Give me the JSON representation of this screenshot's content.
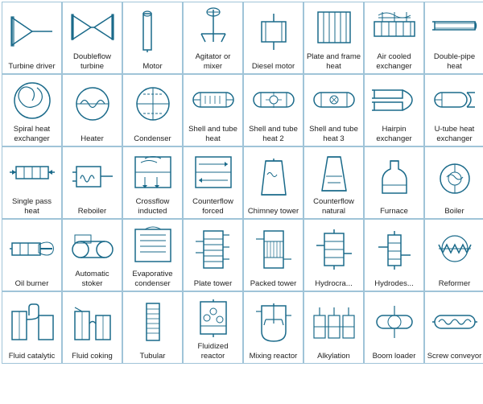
{
  "cells": [
    {
      "label": "Turbine driver"
    },
    {
      "label": "Doubleflow turbine"
    },
    {
      "label": "Motor"
    },
    {
      "label": "Agitator or mixer"
    },
    {
      "label": "Diesel motor"
    },
    {
      "label": "Plate and frame heat"
    },
    {
      "label": "Air cooled exchanger"
    },
    {
      "label": "Double-pipe heat"
    },
    {
      "label": "Spiral heat exchanger"
    },
    {
      "label": "Heater"
    },
    {
      "label": "Condenser"
    },
    {
      "label": "Shell and tube heat"
    },
    {
      "label": "Shell and tube heat 2"
    },
    {
      "label": "Shell and tube heat 3"
    },
    {
      "label": "Hairpin exchanger"
    },
    {
      "label": "U-tube heat exchanger"
    },
    {
      "label": "Single pass heat"
    },
    {
      "label": "Reboiler"
    },
    {
      "label": "Crossflow inducted"
    },
    {
      "label": "Counterflow forced"
    },
    {
      "label": "Chimney tower"
    },
    {
      "label": "Counterflow natural"
    },
    {
      "label": "Furnace"
    },
    {
      "label": "Boiler"
    },
    {
      "label": "Oil burner"
    },
    {
      "label": "Automatic stoker"
    },
    {
      "label": "Evaporative condenser"
    },
    {
      "label": "Plate tower"
    },
    {
      "label": "Packed tower"
    },
    {
      "label": "Hydrocra..."
    },
    {
      "label": "Hydrodes..."
    },
    {
      "label": "Reformer"
    },
    {
      "label": "Fluid catalytic"
    },
    {
      "label": "Fluid coking"
    },
    {
      "label": "Tubular"
    },
    {
      "label": "Fluidized reactor"
    },
    {
      "label": "Mixing reactor"
    },
    {
      "label": "Alkylation"
    },
    {
      "label": "Boom loader"
    },
    {
      "label": "Screw conveyor"
    }
  ]
}
